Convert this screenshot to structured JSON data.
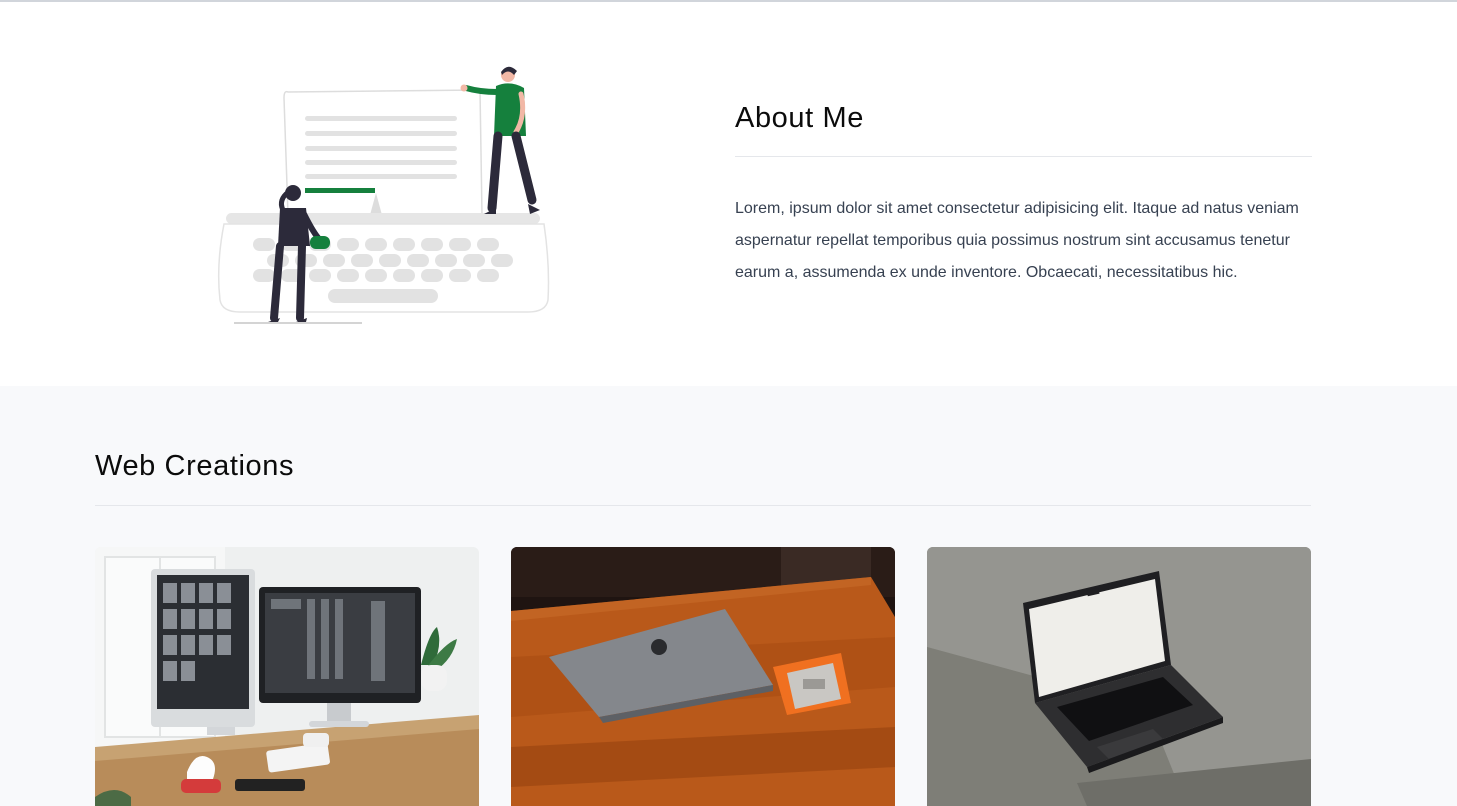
{
  "about": {
    "title": "About Me",
    "body": "Lorem, ipsum dolor sit amet consectetur adipisicing elit. Itaque ad natus veniam aspernatur repellat temporibus quia possimus nostrum sint accusamus tenetur earum a, assumenda ex unde inventore. Obcaecati, necessitatibus hic.",
    "illustration": "typewriter-people-illustration"
  },
  "works": {
    "title": "Web Creations",
    "cards": [
      {
        "image": "desk-with-two-monitors-photo"
      },
      {
        "image": "laptop-on-wooden-table-photo"
      },
      {
        "image": "open-laptop-on-gray-block-photo"
      }
    ]
  },
  "colors": {
    "accent": "#15803d",
    "section_alt_bg": "#f8f9fb",
    "body_text": "#374151",
    "rule": "#e5e7eb"
  }
}
